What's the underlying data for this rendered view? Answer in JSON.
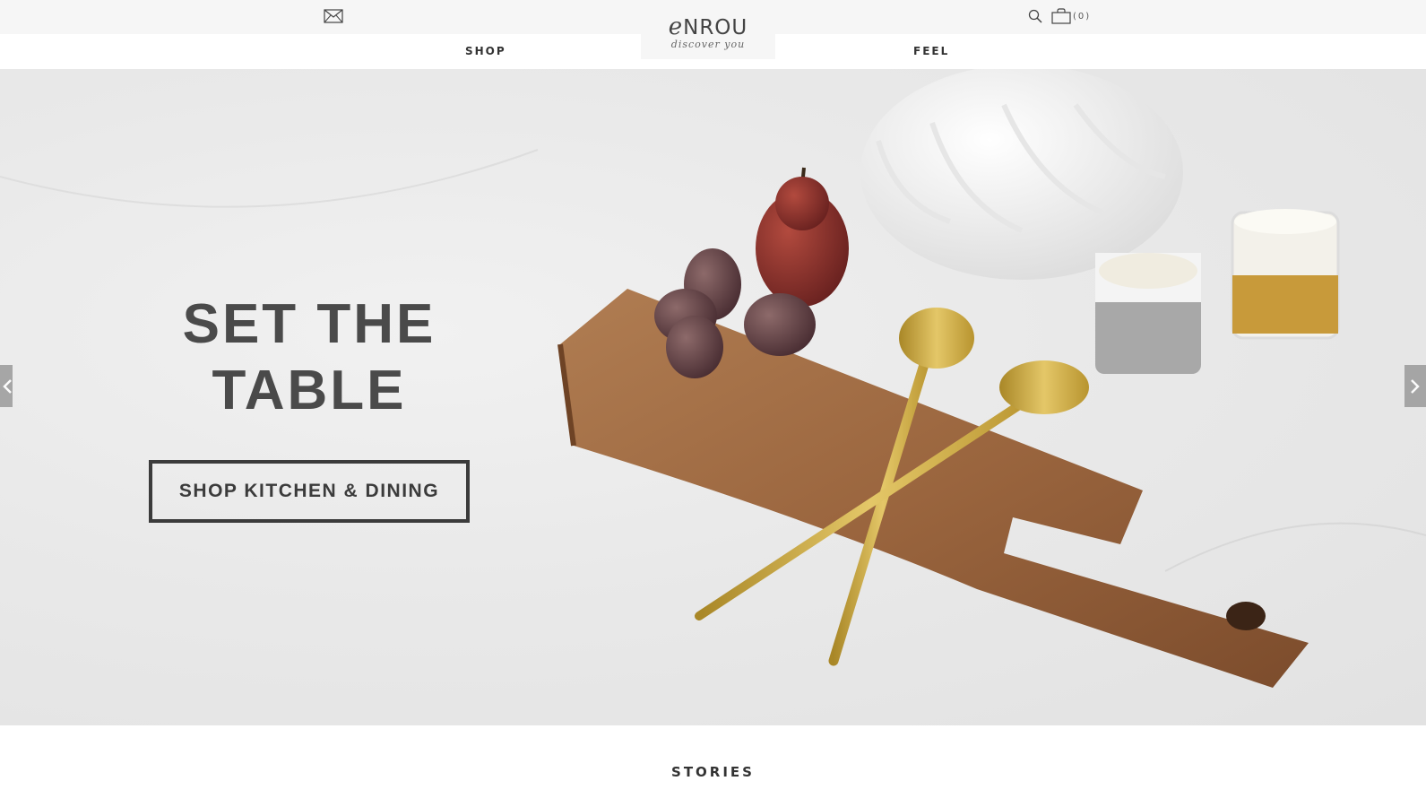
{
  "brand": {
    "name": "NROU",
    "script_initial": "e",
    "tagline": "discover you"
  },
  "topbar": {
    "mail_icon": "mail-icon",
    "search_icon": "search-icon",
    "cart_icon": "bag-icon",
    "cart_count": "(0)"
  },
  "nav": {
    "shop": "SHOP",
    "feel": "FEEL"
  },
  "hero": {
    "title_line1": "SET THE",
    "title_line2": "TABLE",
    "cta": "SHOP KITCHEN & DINING",
    "prev_icon": "chevron-left-icon",
    "next_icon": "chevron-right-icon"
  },
  "section": {
    "stories": "STORIES"
  },
  "colors": {
    "text": "#333333",
    "topbar": "#f6f6f6",
    "hero_bg": "#e9e9e9",
    "wood": "#9b6a43",
    "brass": "#c9a642",
    "pear": "#8a2f2a"
  }
}
